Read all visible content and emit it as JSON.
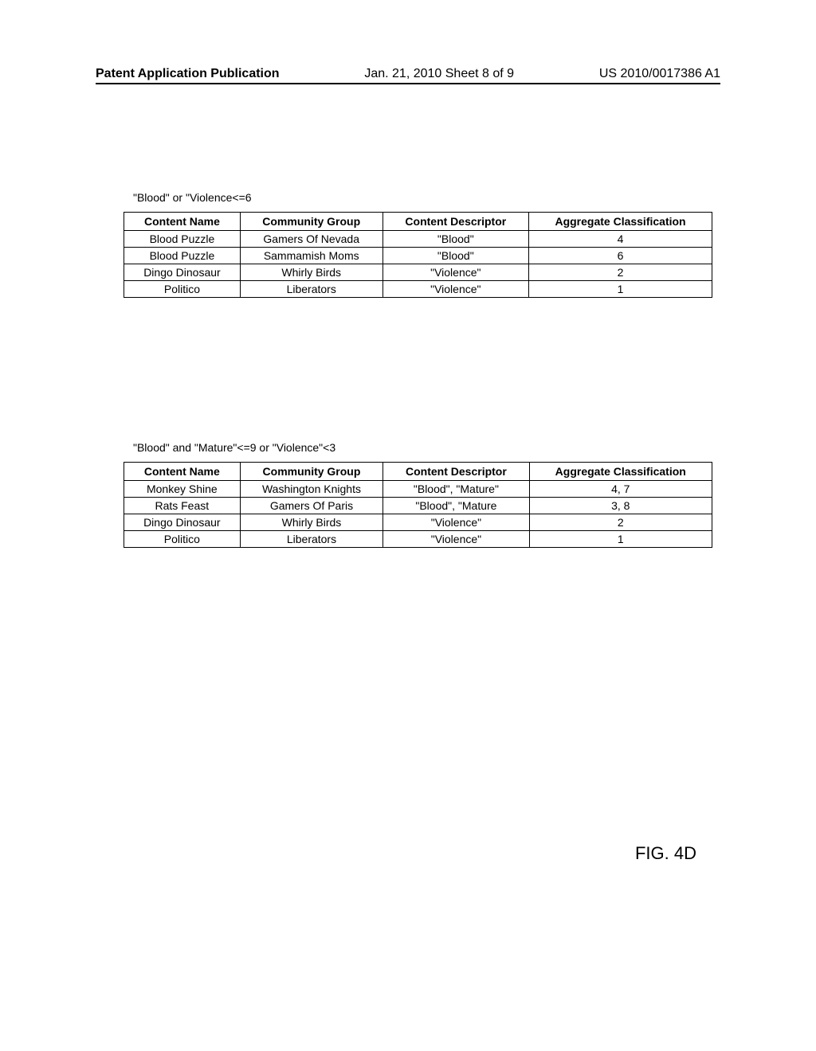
{
  "header": {
    "left": "Patent Application Publication",
    "center": "Jan. 21, 2010  Sheet 8 of 9",
    "right": "US 2010/0017386 A1"
  },
  "section1": {
    "query": "\"Blood\" or \"Violence<=6",
    "columns": [
      "Content Name",
      "Community Group",
      "Content Descriptor",
      "Aggregate Classification"
    ],
    "rows": [
      {
        "content_name": "Blood Puzzle",
        "community_group": "Gamers Of Nevada",
        "content_descriptor": "\"Blood\"",
        "aggregate_classification": "4"
      },
      {
        "content_name": "Blood Puzzle",
        "community_group": "Sammamish Moms",
        "content_descriptor": "\"Blood\"",
        "aggregate_classification": "6"
      },
      {
        "content_name": "Dingo Dinosaur",
        "community_group": "Whirly Birds",
        "content_descriptor": "\"Violence\"",
        "aggregate_classification": "2"
      },
      {
        "content_name": "Politico",
        "community_group": "Liberators",
        "content_descriptor": "\"Violence\"",
        "aggregate_classification": "1"
      }
    ]
  },
  "section2": {
    "query": "\"Blood\" and \"Mature\"<=9 or \"Violence\"<3",
    "columns": [
      "Content Name",
      "Community Group",
      "Content Descriptor",
      "Aggregate Classification"
    ],
    "rows": [
      {
        "content_name": "Monkey Shine",
        "community_group": "Washington Knights",
        "content_descriptor": "\"Blood\", \"Mature\"",
        "aggregate_classification": "4, 7"
      },
      {
        "content_name": "Rats Feast",
        "community_group": "Gamers Of Paris",
        "content_descriptor": "\"Blood\", \"Mature",
        "aggregate_classification": "3, 8"
      },
      {
        "content_name": "Dingo Dinosaur",
        "community_group": "Whirly Birds",
        "content_descriptor": "\"Violence\"",
        "aggregate_classification": "2"
      },
      {
        "content_name": "Politico",
        "community_group": "Liberators",
        "content_descriptor": "\"Violence\"",
        "aggregate_classification": "1"
      }
    ]
  },
  "figure_label": "FIG. 4D"
}
